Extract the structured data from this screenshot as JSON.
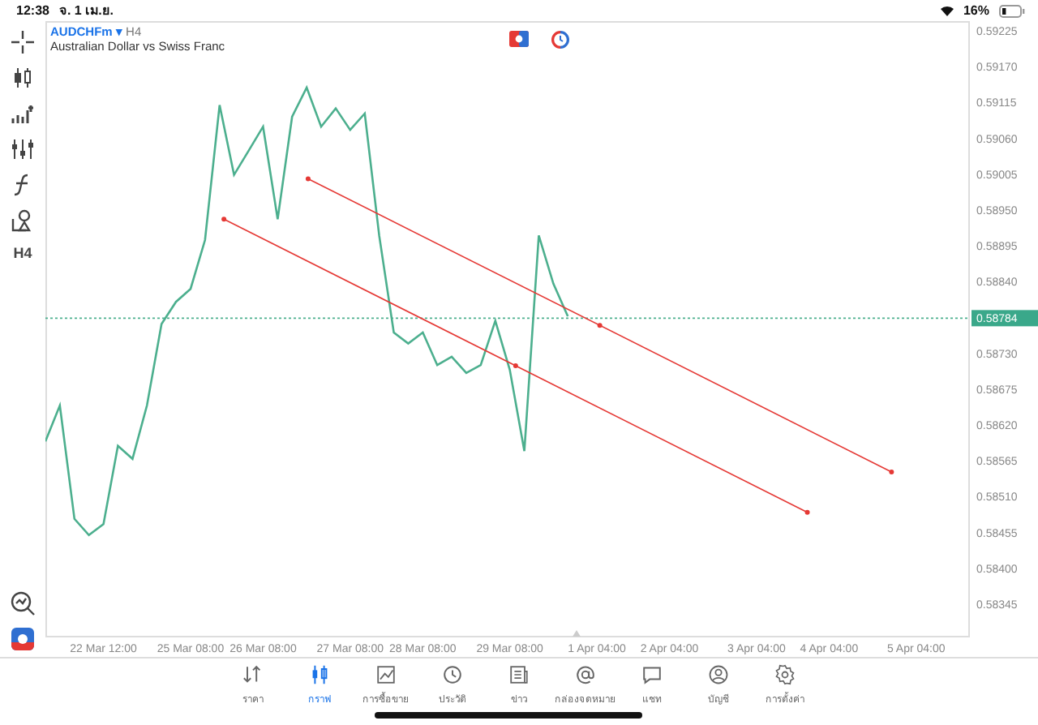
{
  "status_bar": {
    "time": "12:38",
    "date": "จ. 1 เม.ย.",
    "battery": "16%"
  },
  "toolbar": {
    "timeframe": "H4"
  },
  "chart": {
    "dropdown_marker": "▾",
    "timeframe": "H4",
    "description": "Australian Dollar vs Swiss Franc",
    "chart_data": {
      "type": "line",
      "categories": [
        null,
        null,
        null,
        null,
        "22 Mar 12:00",
        null,
        null,
        null,
        null,
        null,
        "25 Mar 08:00",
        null,
        null,
        null,
        null,
        "26 Mar 08:00",
        null,
        null,
        null,
        null,
        null,
        "27 Mar 08:00",
        null,
        null,
        null,
        null,
        "28 Mar 08:00",
        null,
        null,
        null,
        null,
        null,
        "29 Mar 08:00",
        null,
        null,
        null,
        null,
        null,
        "1 Apr 04:00",
        null,
        null,
        null,
        null,
        "2 Apr 04:00",
        null,
        null,
        null,
        null,
        null,
        "3 Apr 04:00",
        null,
        null,
        null,
        null,
        "4 Apr 04:00",
        null,
        null,
        null,
        null,
        null,
        "5 Apr 04:00",
        null,
        null,
        null
      ],
      "series": [
        {
          "name": "AUDCHFm",
          "color": "#4caf8e",
          "values": [
            0.58595,
            0.5865,
            0.58476,
            0.58451,
            0.58468,
            0.58588,
            0.58568,
            0.5865,
            0.58775,
            0.58809,
            0.58829,
            0.58904,
            0.59111,
            0.59004,
            0.59041,
            0.59078,
            0.58936,
            0.59093,
            0.59138,
            0.59078,
            0.59106,
            0.59073,
            0.59098,
            0.58911,
            0.58762,
            0.58745,
            0.58762,
            0.58712,
            0.58725,
            0.587,
            0.58712,
            0.5878,
            0.58705,
            0.5858,
            0.58911,
            0.58837,
            0.58787,
            null,
            null,
            null,
            null,
            null,
            null,
            null,
            null,
            null,
            null,
            null,
            null,
            null,
            null,
            null,
            null,
            null,
            null,
            null,
            null,
            null,
            null,
            null,
            null,
            null,
            null,
            null
          ]
        }
      ],
      "ylim": [
        0.58294,
        0.5924
      ],
      "ref_lines": [
        {
          "axis": "y",
          "value": 0.58784,
          "label": "0.58784"
        }
      ],
      "yticks": [
        {
          "value": 0.59225,
          "label": "0.59225"
        },
        {
          "value": 0.5917,
          "label": "0.59170"
        },
        {
          "value": 0.59115,
          "label": "0.59115"
        },
        {
          "value": 0.5906,
          "label": "0.59060"
        },
        {
          "value": 0.59005,
          "label": "0.59005"
        },
        {
          "value": 0.5895,
          "label": "0.58950"
        },
        {
          "value": 0.58895,
          "label": "0.58895"
        },
        {
          "value": 0.5884,
          "label": "0.58840"
        },
        {
          "value": 0.5873,
          "label": "0.58730"
        },
        {
          "value": 0.58675,
          "label": "0.58675"
        },
        {
          "value": 0.5862,
          "label": "0.58620"
        },
        {
          "value": 0.58565,
          "label": "0.58565"
        },
        {
          "value": 0.5851,
          "label": "0.58510"
        },
        {
          "value": 0.58455,
          "label": "0.58455"
        },
        {
          "value": 0.584,
          "label": "0.58400"
        },
        {
          "value": 0.58345,
          "label": "0.58345"
        }
      ]
    }
  },
  "tabs": [
    {
      "label": "ราคา",
      "selected": false
    },
    {
      "label": "กราฟ",
      "selected": true
    },
    {
      "label": "การซื้อขาย",
      "selected": false
    },
    {
      "label": "ประวัติ",
      "selected": false
    },
    {
      "label": "ข่าว",
      "selected": false
    },
    {
      "label": "กล่องจดหมาย",
      "selected": false
    },
    {
      "label": "แชท",
      "selected": false
    },
    {
      "label": "บัญชี",
      "selected": false
    },
    {
      "label": "การตั้งค่า",
      "selected": false
    }
  ]
}
